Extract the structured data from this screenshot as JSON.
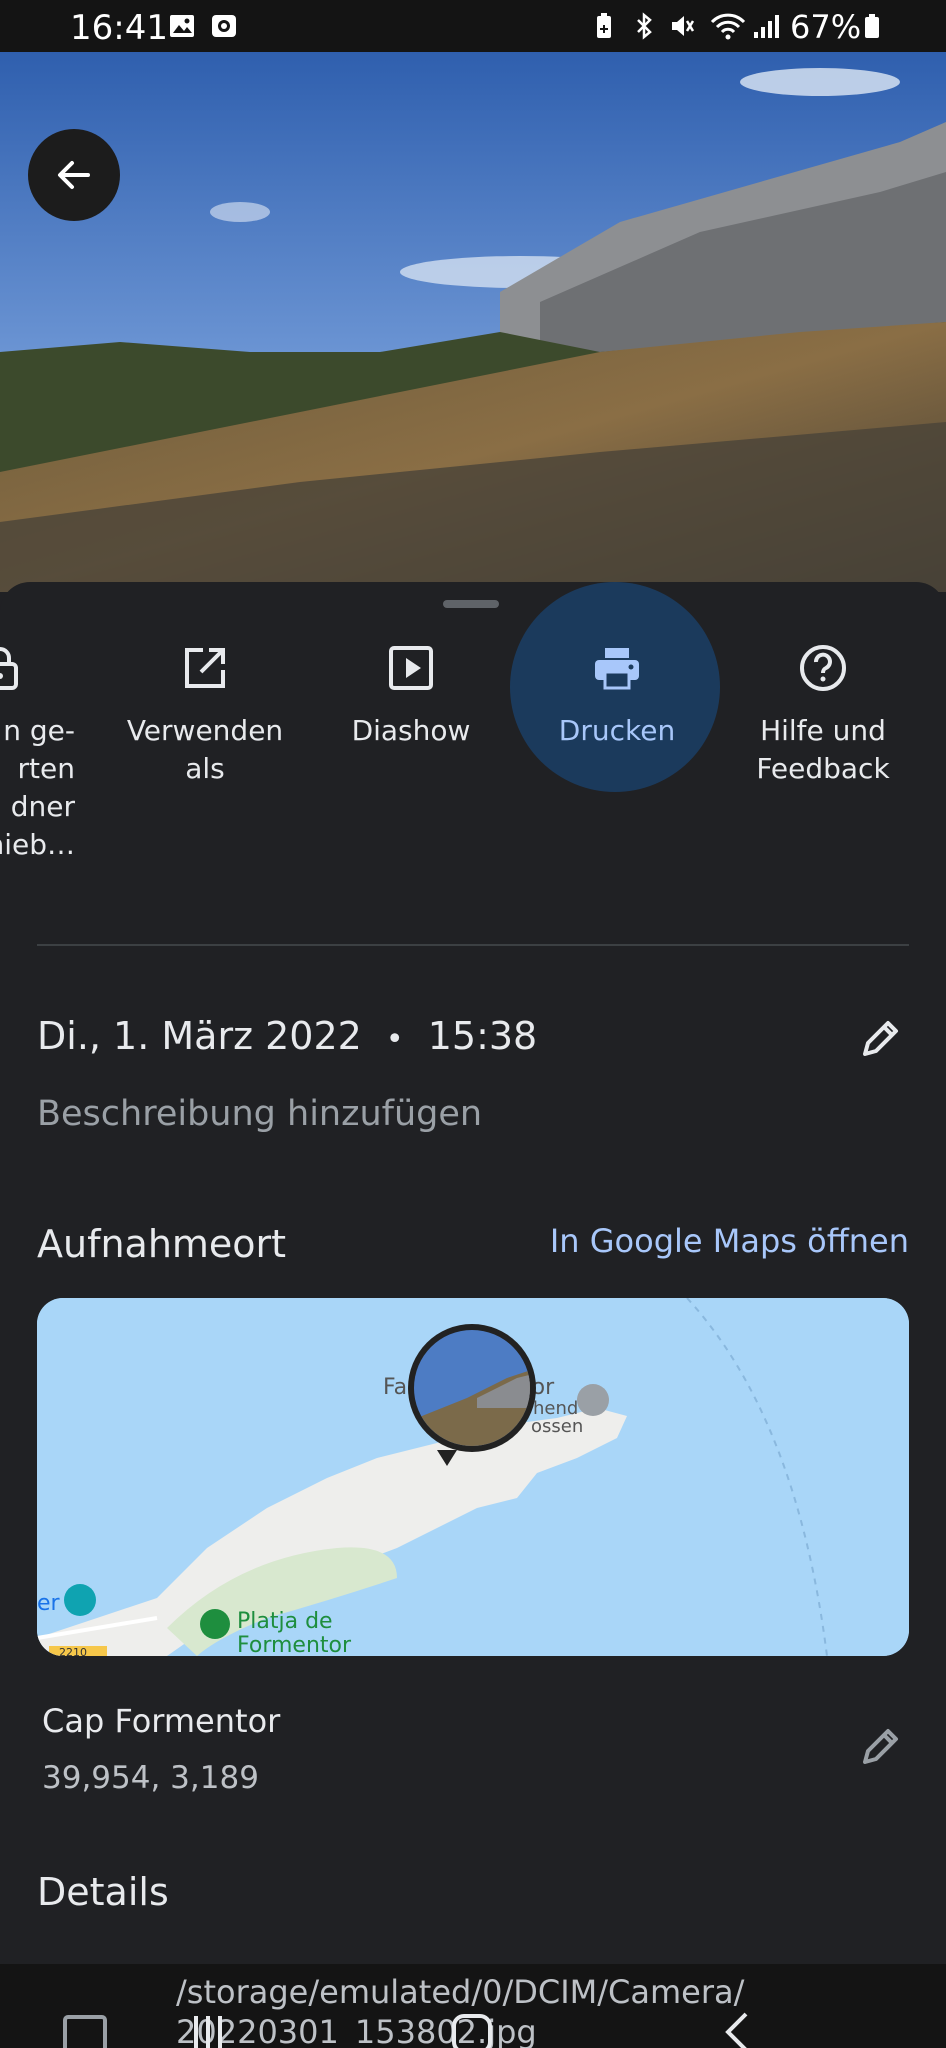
{
  "status_bar": {
    "time": "16:41",
    "battery": "67%"
  },
  "actions": [
    {
      "label": "n ge-\nrten\ndner\nhieb…",
      "icon": "lock-folder-icon"
    },
    {
      "label": "Verwenden\nals",
      "icon": "open-external-icon"
    },
    {
      "label": "Diashow",
      "icon": "slideshow-icon"
    },
    {
      "label": "Drucken",
      "icon": "print-icon"
    },
    {
      "label": "Hilfe und\nFeedback",
      "icon": "help-icon"
    }
  ],
  "info": {
    "date": "Di., 1. März 2022",
    "separator": "•",
    "time": "15:38",
    "description_placeholder": "Beschreibung hinzufügen"
  },
  "location": {
    "title": "Aufnahmeort",
    "maps_link": "In Google Maps öffnen",
    "place": "Cap Formentor",
    "coordinates": "39,954, 3,189",
    "map_labels": {
      "lighthouse_left": "Fa",
      "lighthouse_right": "tor",
      "lighthouse_sub1": "hend",
      "lighthouse_sub2": "ossen",
      "beach_line1": "Platja de",
      "beach_line2": "Formentor",
      "left_edge": "er",
      "road": "2210"
    }
  },
  "details": {
    "title": "Details",
    "path_line1": "/storage/emulated/0/DCIM/Camera/",
    "path_line2": "20220301_153802.jpg"
  },
  "colors": {
    "accent": "#a8c7fa",
    "sheet_bg": "#202124",
    "print_highlight": "#1b3a5c"
  }
}
